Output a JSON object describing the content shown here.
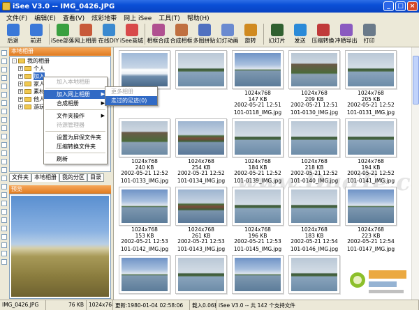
{
  "window": {
    "title": "iSee V3.0 -- IMG_0426.JPG"
  },
  "menubar": [
    "文件(F)",
    "编辑(E)",
    "查看(V)",
    "炫彩地带",
    "网上 iSee",
    "工具(T)",
    "帮助(H)"
  ],
  "toolbar": [
    {
      "label": "后退",
      "icon": "back-icon",
      "color": "#3a78d8"
    },
    {
      "label": "前进",
      "icon": "forward-icon",
      "color": "#3a78d8"
    },
    {
      "label": "iSee部落",
      "icon": "tribe-icon",
      "color": "#3aa040"
    },
    {
      "label": "网上相册",
      "icon": "web-album-icon",
      "color": "#c85a3a"
    },
    {
      "label": "在线DIY",
      "icon": "diy-icon",
      "color": "#3a8ad0"
    },
    {
      "label": "iSee商城",
      "icon": "store-icon",
      "color": "#d84a4a"
    },
    {
      "label": "相框合成",
      "icon": "frame-icon",
      "color": "#b05090"
    },
    {
      "label": "合成相框",
      "icon": "compose-icon",
      "color": "#c07040"
    },
    {
      "label": "多图拼贴",
      "icon": "collage-icon",
      "color": "#5070c0"
    },
    {
      "label": "幻灯动画",
      "icon": "animation-icon",
      "color": "#6a8ad0"
    },
    {
      "label": "旋转",
      "icon": "rotate-icon",
      "color": "#d08a20"
    },
    {
      "label": "幻灯片",
      "icon": "slideshow-icon",
      "color": "#306030"
    },
    {
      "label": "发送",
      "icon": "send-icon",
      "color": "#2a8ad8"
    },
    {
      "label": "压缩转换",
      "icon": "compress-icon",
      "color": "#c03a3a"
    },
    {
      "label": "冲晒导出",
      "icon": "print-export-icon",
      "color": "#8a5ac0"
    },
    {
      "label": "打印",
      "icon": "printer-icon",
      "color": "#6a7a8a"
    }
  ],
  "tree": {
    "header": "本地相册",
    "items": [
      {
        "label": "我的相册",
        "level": 0,
        "expander": "-"
      },
      {
        "label": "个人",
        "level": 1,
        "expander": "+"
      },
      {
        "label": "加入",
        "level": 1,
        "expander": "+"
      },
      {
        "label": "家人",
        "level": 1,
        "expander": "+"
      },
      {
        "label": "素材",
        "level": 1,
        "expander": "+"
      },
      {
        "label": "他人",
        "level": 1,
        "expander": "+"
      },
      {
        "label": "游玩",
        "level": 1,
        "expander": "+"
      }
    ]
  },
  "left_tabs": [
    "文件夹",
    "本地相册",
    "我的分区",
    "目录"
  ],
  "preview": {
    "header": "预览"
  },
  "context_menu": {
    "items": [
      {
        "label": "加入本地相册",
        "disabled": true,
        "submenu": false
      },
      {
        "label": "加入网上相册",
        "disabled": false,
        "submenu": true,
        "highlight": true
      },
      {
        "label": "合成相册",
        "disabled": false,
        "submenu": true
      },
      {
        "label": "文件夹操作",
        "disabled": false,
        "submenu": true
      },
      {
        "label": "待源管理器",
        "disabled": true,
        "submenu": false
      },
      {
        "label": "设置为屏保文件夹",
        "disabled": false,
        "submenu": false
      },
      {
        "label": "压缩转换文件夹",
        "disabled": false,
        "submenu": false
      },
      {
        "label": "刷新",
        "disabled": false,
        "submenu": false
      }
    ]
  },
  "submenu": {
    "items": [
      {
        "label": "更多相册",
        "disabled": true
      },
      {
        "label": "走过的足迹(0)",
        "disabled": false,
        "highlight": true
      }
    ]
  },
  "thumbnails": [
    {
      "dims": "",
      "size": "",
      "date": "",
      "name": "",
      "scene": "boat"
    },
    {
      "dims": "",
      "size": "",
      "date": "",
      "name": "",
      "scene": "island"
    },
    {
      "dims": "1024x768",
      "size": "147 KB",
      "date": "2002-05-21 12:51",
      "name": "101-0118_IMG.jpg",
      "scene": "cloudy"
    },
    {
      "dims": "1024x768",
      "size": "209 KB",
      "date": "2002-05-21 12:51",
      "name": "101-0130_IMG.jpg",
      "scene": "castle"
    },
    {
      "dims": "1024x768",
      "size": "205 KB",
      "date": "2002-05-21 12:52",
      "name": "101-0131_IMG.jpg",
      "scene": "island"
    },
    {
      "dims": "1024x768",
      "size": "240 KB",
      "date": "2002-05-21 12:52",
      "name": "101-0133_IMG.jpg",
      "scene": "castle"
    },
    {
      "dims": "1024x768",
      "size": "254 KB",
      "date": "2002-05-21 12:52",
      "name": "101-0134_IMG.jpg",
      "scene": "house"
    },
    {
      "dims": "1024x768",
      "size": "184 KB",
      "date": "2002-05-21 12:52",
      "name": "101-0139_IMG.jpg",
      "scene": "island"
    },
    {
      "dims": "1024x768",
      "size": "218 KB",
      "date": "2002-05-21 12:52",
      "name": "101-0140_IMG.jpg",
      "scene": "island"
    },
    {
      "dims": "1024x768",
      "size": "194 KB",
      "date": "2002-05-21 12:52",
      "name": "101-0141_IMG.jpg",
      "scene": "island"
    },
    {
      "dims": "1024x768",
      "size": "153 KB",
      "date": "2002-05-21 12:53",
      "name": "101-0142_IMG.jpg",
      "scene": "cloudy"
    },
    {
      "dims": "1024x768",
      "size": "261 KB",
      "date": "2002-05-21 12:53",
      "name": "101-0143_IMG.jpg",
      "scene": "house"
    },
    {
      "dims": "1024x768",
      "size": "196 KB",
      "date": "2002-05-21 12:53",
      "name": "101-0145_IMG.jpg",
      "scene": "island"
    },
    {
      "dims": "1024x768",
      "size": "183 KB",
      "date": "2002-05-21 12:54",
      "name": "101-0146_IMG.jpg",
      "scene": "island"
    },
    {
      "dims": "1024x768",
      "size": "223 KB",
      "date": "2002-05-21 12:54",
      "name": "101-0147_IMG.jpg",
      "scene": "cloudy"
    },
    {
      "dims": "",
      "size": "",
      "date": "",
      "name": "",
      "scene": "cloudy"
    },
    {
      "dims": "",
      "size": "",
      "date": "",
      "name": "",
      "scene": "island"
    },
    {
      "dims": "",
      "size": "",
      "date": "",
      "name": "",
      "scene": "cloudy"
    },
    {
      "dims": "",
      "size": "",
      "date": "",
      "name": "",
      "scene": "island"
    }
  ],
  "watermark": "www.DuoTe.com",
  "status": {
    "file": "IMG_0426.JPG",
    "size": "76 KB",
    "dims": "1024x768",
    "updated": "更新:1980-01-04 02:58:06",
    "loaded": "载入0.06秒",
    "version": "iSee V3.0 -- 共 142 个支持文件"
  },
  "colors": {
    "title_bar": "#0a4fd6",
    "panel_header": "#e07a20",
    "highlight": "#316ac5"
  }
}
